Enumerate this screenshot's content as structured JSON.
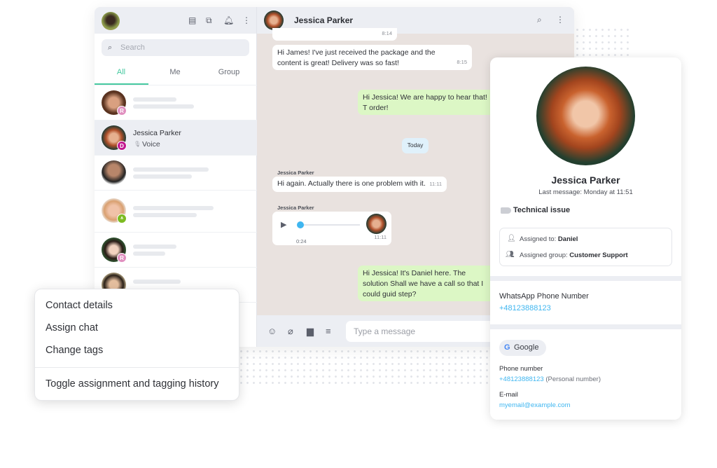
{
  "sidebar": {
    "search_placeholder": "Search",
    "tabs": [
      {
        "label": "All",
        "active": true
      },
      {
        "label": "Me"
      },
      {
        "label": "Group"
      }
    ],
    "active_chat": {
      "name": "Jessica Parker",
      "preview": "Voice",
      "badge": "D"
    },
    "badges": [
      "R",
      "R"
    ],
    "icons": [
      "chat-icon",
      "multi-chat-icon",
      "bell-icon",
      "more-vertical-icon"
    ]
  },
  "chat": {
    "contact_name": "Jessica Parker",
    "messages": [
      {
        "time": "8:14"
      },
      {
        "text": "Hi James! I've just received the package and the content is great! Delivery was so fast!",
        "time": "8:15"
      },
      {
        "text": "Hi Jessica! We are happy to hear that! T order!"
      },
      {
        "divider": "Today"
      },
      {
        "sender": "Jessica Parker",
        "text": "Hi again. Actually there is one problem with it.",
        "time": "11:11"
      },
      {
        "sender": "Jessica Parker",
        "voice_duration": "0:24",
        "time": "11:11",
        "progress": 0.02
      },
      {
        "text": "Hi Jessica! It's Daniel here. The solution Shall we have a call so that I could guid step?"
      }
    ],
    "input_placeholder": "Type a message"
  },
  "context_menu": {
    "items": [
      "Contact details",
      "Assign chat",
      "Change tags",
      "Toggle assignment and tagging history"
    ]
  },
  "contact": {
    "name": "Jessica Parker",
    "last_message": "Last message: Monday at 11:51",
    "tag": "Technical issue",
    "assigned_to_label": "Assigned to: ",
    "assigned_to": "Daniel",
    "assigned_group_label": "Assigned group: ",
    "assigned_group": "Customer Support",
    "whatsapp_label": "WhatsApp Phone Number",
    "whatsapp": "+48123888123",
    "source": "Google",
    "phone_label": "Phone number",
    "phone": "+48123888123",
    "phone_note": "(Personal number)",
    "email_label": "E-mail",
    "email": "myemail@example.com"
  },
  "colors": {
    "accent": "#3fb6f0",
    "tab_active": "#46c9a0",
    "outgoing": "#dcf7c5",
    "chat_bg": "#e9e2df",
    "badge_r": "#e08fbf",
    "badge_d": "#c2188f",
    "badge_group": "#7dbb22"
  }
}
